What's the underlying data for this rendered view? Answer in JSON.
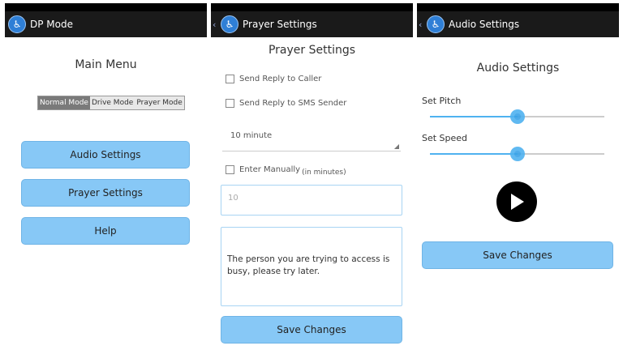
{
  "screen1": {
    "title": "DP Mode",
    "heading": "Main Menu",
    "modes": [
      "Normal Mode",
      "Drive Mode",
      "Prayer Mode"
    ],
    "selected_mode": "Normal Mode",
    "buttons": [
      "Audio Settings",
      "Prayer Settings",
      "Help"
    ]
  },
  "screen2": {
    "title": "Prayer Settings",
    "heading": "Prayer Settings",
    "checkbox_caller": "Send Reply to Caller",
    "checkbox_sms": "Send Reply to SMS Sender",
    "duration": "10 minute",
    "manual_label": "Enter Manually",
    "manual_sub": "(in minutes)",
    "minutes_placeholder": "10",
    "message": "The person you are trying to access is busy, please try later.",
    "save": "Save Changes"
  },
  "screen3": {
    "title": "Audio Settings",
    "heading": "Audio Settings",
    "pitch_label": "Set Pitch",
    "speed_label": "Set Speed",
    "pitch_value": 0.5,
    "speed_value": 0.5,
    "save": "Save Changes"
  },
  "colors": {
    "accent": "#87c8f6",
    "slider": "#4fb2f0"
  }
}
